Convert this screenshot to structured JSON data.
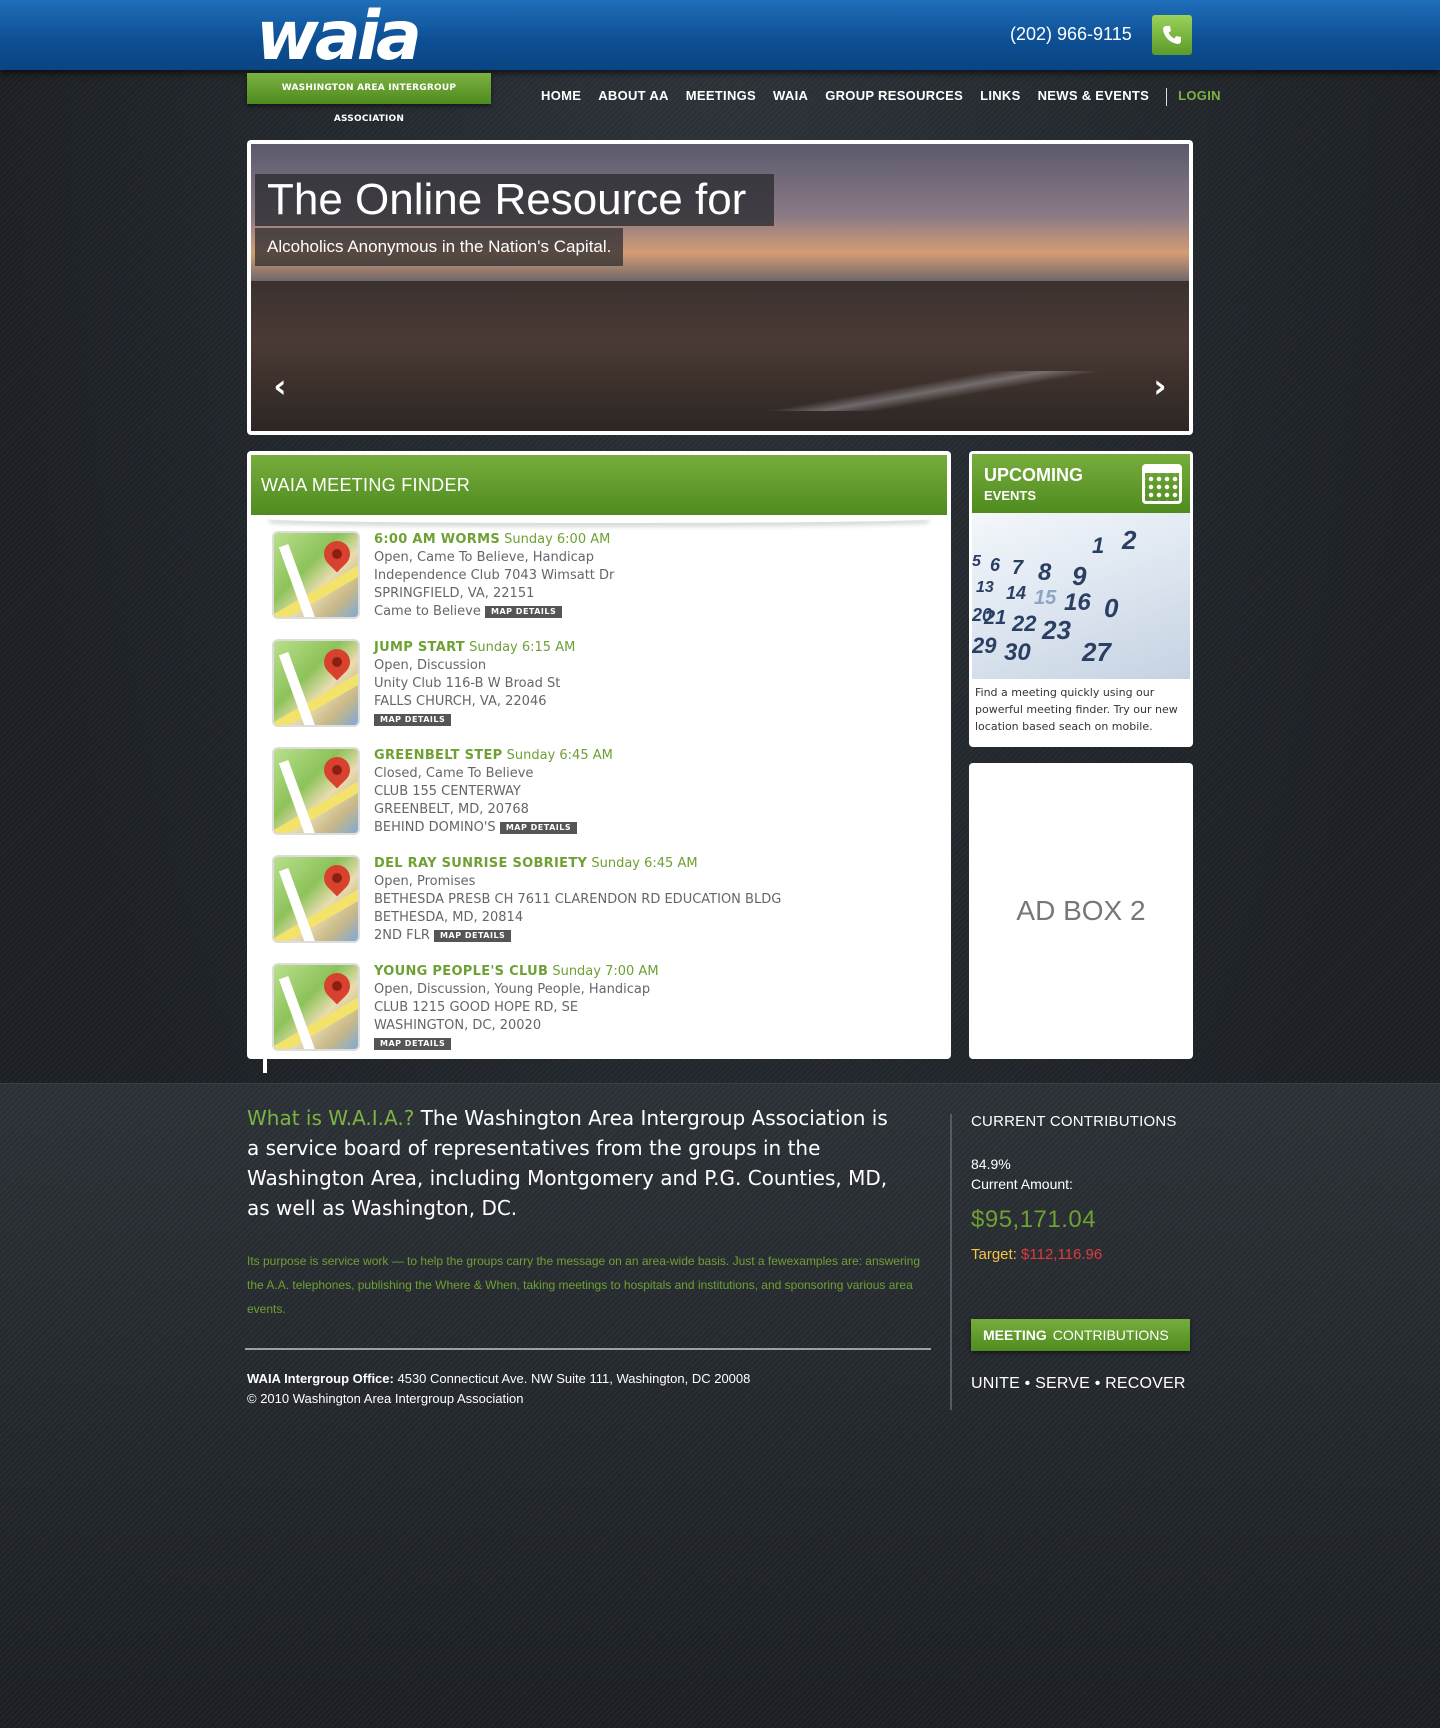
{
  "header": {
    "logo_text": "waia",
    "logo_tagline": "WASHINGTON AREA INTERGROUP ASSOCIATION",
    "phone": "(202) 966-9115"
  },
  "nav": {
    "items": [
      "HOME",
      "ABOUT AA",
      "MEETINGS",
      "WAIA",
      "GROUP RESOURCES",
      "LINKS",
      "NEWS & EVENTS"
    ],
    "login": "LOGIN"
  },
  "hero": {
    "title": "The Online Resource for",
    "subtitle": "Alcoholics Anonymous in the Nation's Capital.",
    "prev_icon": "chevron-left-icon",
    "next_icon": "chevron-right-icon"
  },
  "finder": {
    "title": "WAIA MEETING FINDER",
    "map_details_label": "MAP DETAILS",
    "meetings": [
      {
        "name": "6:00 AM WORMS",
        "time": "Sunday 6:00 AM",
        "types": "Open, Came To Believe, Handicap",
        "address": "Independence Club 7043 Wimsatt Dr",
        "city": "SPRINGFIELD, VA, 22151",
        "note": "Came to Believe"
      },
      {
        "name": "JUMP START",
        "time": "Sunday 6:15 AM",
        "types": "Open, Discussion",
        "address": "Unity Club 116-B W Broad St",
        "city": "FALLS CHURCH, VA, 22046",
        "note": ""
      },
      {
        "name": "GREENBELT STEP",
        "time": "Sunday 6:45 AM",
        "types": "Closed, Came To Believe",
        "address": "CLUB 155 CENTERWAY",
        "city": "GREENBELT, MD, 20768",
        "note": "BEHIND DOMINO'S"
      },
      {
        "name": "DEL RAY SUNRISE SOBRIETY",
        "time": "Sunday 6:45 AM",
        "types": "Open, Promises",
        "address": "BETHESDA PRESB CH 7611 CLARENDON RD EDUCATION BLDG",
        "city": "BETHESDA, MD, 20814",
        "note": "2ND FLR"
      },
      {
        "name": "YOUNG PEOPLE'S CLUB",
        "time": "Sunday 7:00 AM",
        "types": "Open, Discussion, Young People, Handicap",
        "address": "CLUB 1215 GOOD HOPE RD, SE",
        "city": "WASHINGTON, DC, 20020",
        "note": ""
      }
    ]
  },
  "events": {
    "title": "UPCOMING",
    "subtitle": "EVENTS",
    "description": "Find a meeting quickly using our powerful meeting finder. Try our new location based seach on mobile."
  },
  "adbox": {
    "label": "AD BOX 2"
  },
  "footer": {
    "what_heading": "What is W.A.I.A.?",
    "what_body": "The Washington Area Intergroup Association is a service board of representatives from the groups in the Washington Area, including Montgomery and P.G. Counties, MD, as well as Washington, DC.",
    "purpose": "Its purpose is service work — to help the groups carry the message on an area-wide basis. Just a fewexamples are: answering the A.A. telephones, publishing the Where & When, taking meetings to hospitals and institutions, and sponsoring various area events.",
    "office_label": "WAIA Intergroup Office:",
    "office_address": "4530 Connecticut Ave. NW Suite 111, Washington, DC 20008",
    "copyright": "© 2010 Washington Area Intergroup Association"
  },
  "contributions": {
    "heading": "CURRENT CONTRIBUTIONS",
    "percent": "84.9%",
    "current_label": "Current Amount:",
    "amount": "$95,171.04",
    "target_label": "Target:",
    "target_amount": "$112,116.96",
    "button_bold": "MEETING",
    "button_rest": "CONTRIBUTIONS",
    "motto": "UNITE • SERVE • RECOVER"
  },
  "colors": {
    "brand_blue": "#0d4e93",
    "brand_green": "#6ea033",
    "target_red": "#e03a3a",
    "target_label_yellow": "#f4c542"
  }
}
